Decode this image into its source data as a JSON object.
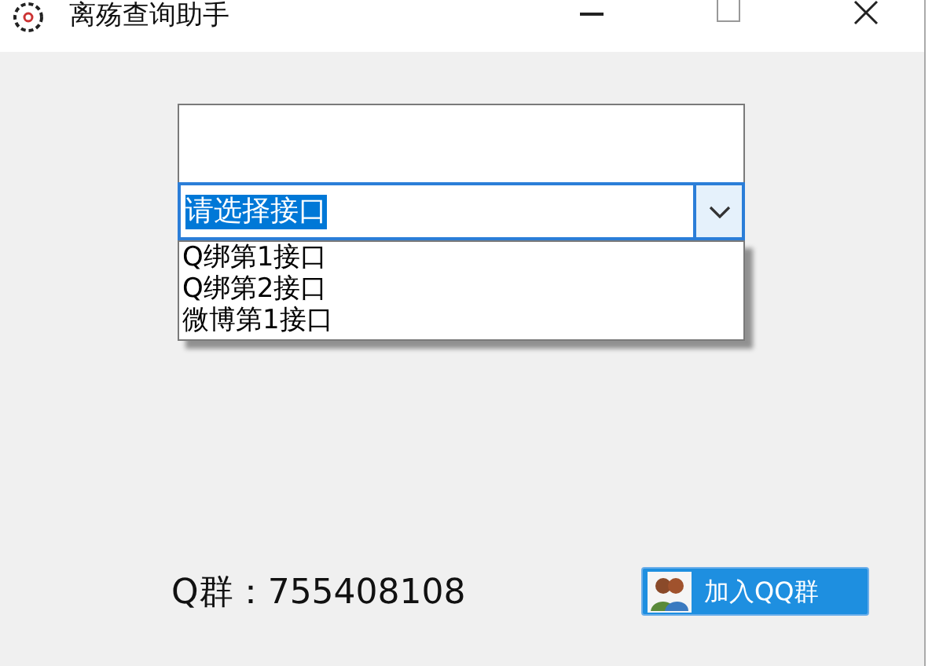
{
  "window": {
    "title": "离殇查询助手"
  },
  "combo": {
    "value": "请选择接口",
    "text_selected": true,
    "expanded": true
  },
  "options": [
    {
      "label": "Q绑第1接口"
    },
    {
      "label": "Q绑第2接口"
    },
    {
      "label": "微博第1接口"
    }
  ],
  "qq_group": {
    "label": "Q群：755408108"
  },
  "join_button": {
    "label": "加入QQ群"
  }
}
